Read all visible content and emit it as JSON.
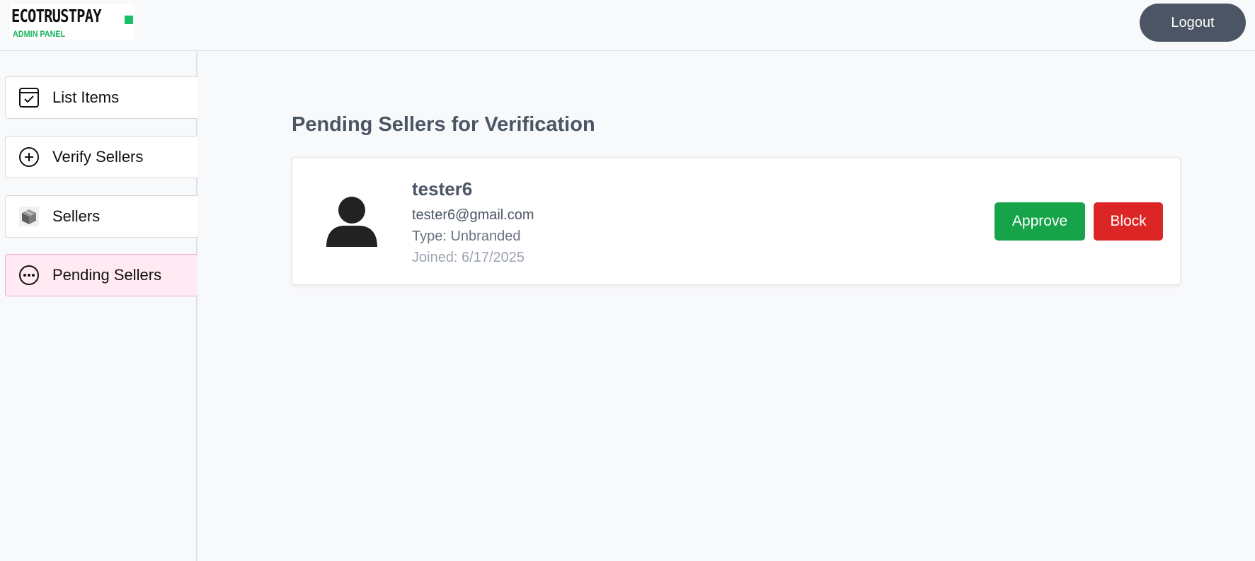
{
  "header": {
    "logo_title": "ECOTRUSTPAY",
    "logo_subtitle": "ADMIN PANEL",
    "logout_label": "Logout"
  },
  "sidebar": {
    "items": [
      {
        "label": "List Items",
        "icon": "checkbox-calendar-icon",
        "active": false
      },
      {
        "label": "Verify Sellers",
        "icon": "plus-circle-icon",
        "active": false
      },
      {
        "label": "Sellers",
        "icon": "package-icon",
        "active": false
      },
      {
        "label": "Pending Sellers",
        "icon": "ellipsis-circle-icon",
        "active": true
      }
    ]
  },
  "main": {
    "title": "Pending Sellers for Verification",
    "sellers": [
      {
        "name": "tester6",
        "email": "tester6@gmail.com",
        "type": "Type: Unbranded",
        "joined": "Joined: 6/17/2025",
        "avatar_icon": "user-silhouette-icon",
        "approve_label": "Approve",
        "block_label": "Block"
      }
    ]
  },
  "colors": {
    "approve": "#16a34a",
    "block": "#dc2626",
    "logout": "#4b5563",
    "active_nav": "#ffe9f2",
    "brand_green": "#18c06a"
  }
}
